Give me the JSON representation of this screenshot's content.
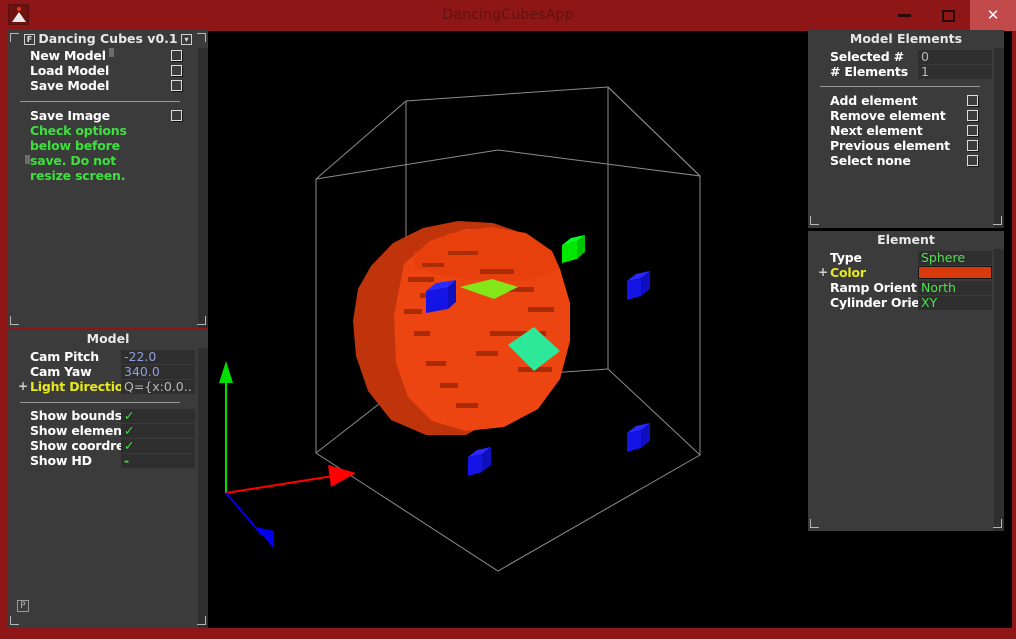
{
  "window": {
    "title": "DancingCubesApp",
    "app_icon": "mountain-app-icon",
    "minimize_label": "–",
    "maximize_label": "□",
    "close_label": "✕",
    "frame_color": "#8f1616",
    "close_button_color": "#c24a4a"
  },
  "left_panel": {
    "title": "Dancing Cubes v0.1",
    "header_left_icon": "F",
    "header_right_icon": "▾",
    "buttons": [
      {
        "label": "New Model"
      },
      {
        "label": "Load Model"
      },
      {
        "label": "Save Model"
      },
      {
        "label": "Save Image"
      }
    ],
    "note_lines": [
      "Check options",
      "below before",
      "save. Do not",
      "resize screen."
    ],
    "note_color": "#3de03d"
  },
  "model_panel": {
    "title": "Model",
    "fields": [
      {
        "label": "Cam Pitch",
        "value": "-22.0",
        "style": "num",
        "expandable": false
      },
      {
        "label": "Cam Yaw",
        "value": "340.0",
        "style": "num",
        "expandable": false
      },
      {
        "label": "Light Direction",
        "value": "Q={x:0.0..",
        "style": "dim",
        "expandable": true,
        "label_color": "yellow"
      }
    ],
    "toggles": [
      {
        "label": "Show bounds",
        "value": "✓",
        "checked": true
      },
      {
        "label": "Show element..",
        "value": "✓",
        "checked": true
      },
      {
        "label": "Show coordref",
        "value": "✓",
        "checked": true
      },
      {
        "label": "Show HD",
        "value": "-",
        "checked": false
      }
    ]
  },
  "model_elements_panel": {
    "title": "Model Elements",
    "fields": [
      {
        "label": "Selected #",
        "value": "0"
      },
      {
        "label": "# Elements",
        "value": "1"
      }
    ],
    "buttons": [
      {
        "label": "Add element"
      },
      {
        "label": "Remove element"
      },
      {
        "label": "Next element"
      },
      {
        "label": "Previous element"
      },
      {
        "label": "Select none"
      }
    ]
  },
  "element_panel": {
    "title": "Element",
    "fields": [
      {
        "label": "Type",
        "value": "Sphere",
        "style": "grn",
        "expandable": false
      },
      {
        "label": "Color",
        "value": "",
        "style": "swatch",
        "expandable": true,
        "label_color": "yellow",
        "swatch_color": "#d93a0c"
      },
      {
        "label": "Ramp Orient",
        "value": "North",
        "style": "grn",
        "expandable": false
      },
      {
        "label": "Cylinder Orient",
        "value": "XY",
        "style": "grn",
        "expandable": false
      }
    ]
  },
  "viewport": {
    "background": "#000000",
    "bounds_color": "#8c8c8c",
    "axes": [
      {
        "name": "x-axis",
        "color": "#ff0000"
      },
      {
        "name": "y-axis",
        "color": "#00dd00"
      },
      {
        "name": "z-axis",
        "color": "#0000ee"
      }
    ],
    "sphere_color": "#ec4511",
    "marker_green": "#00e800",
    "marker_blue": "#1414e6",
    "patch_lime": "#84e818",
    "patch_mint": "#2ee89a"
  },
  "status": {
    "resize_glyph": "P"
  }
}
